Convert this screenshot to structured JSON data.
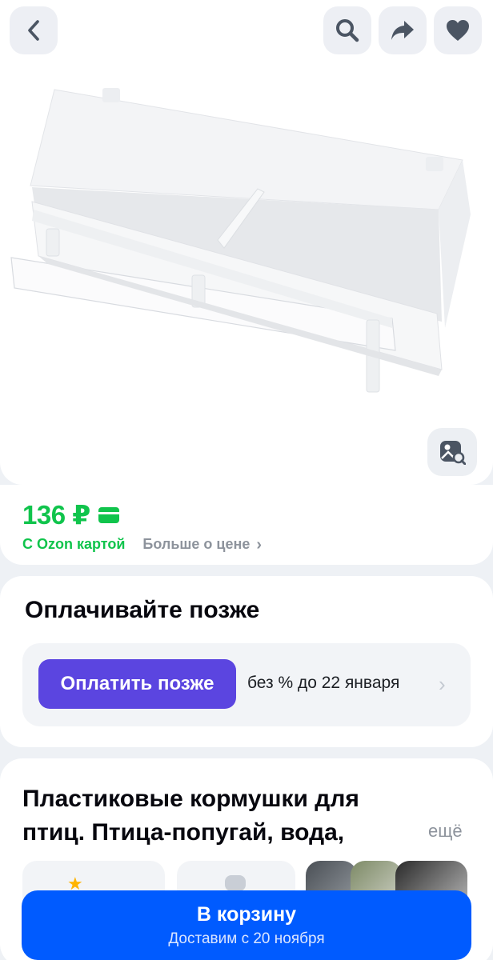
{
  "header": {
    "back_icon": "chevron-left-icon",
    "search_icon": "search-icon",
    "share_icon": "share-arrow-icon",
    "favorite_icon": "heart-icon"
  },
  "gallery": {
    "image_alt": "Пластиковая кормушка для птиц",
    "visual_search_icon": "image-search-icon"
  },
  "price": {
    "value": "136 ₽",
    "card_icon": "ozon-card-icon",
    "ozon_card_label": "С Ozon картой",
    "more_label": "Больше о цене",
    "more_icon": "chevron-right-icon",
    "accent": "#10c44c"
  },
  "paylater": {
    "title": "Оплачивайте позже",
    "button_label": "Оплатить позже",
    "terms": "без % до 22 января",
    "accent": "#5b45e0"
  },
  "product": {
    "title": "Пластиковые кормушки для птиц. Птица-попугай, вода,",
    "more_label": "ещё"
  },
  "cta": {
    "title": "В корзину",
    "subtitle": "Доставим с 20 ноября",
    "accent": "#005bff"
  }
}
